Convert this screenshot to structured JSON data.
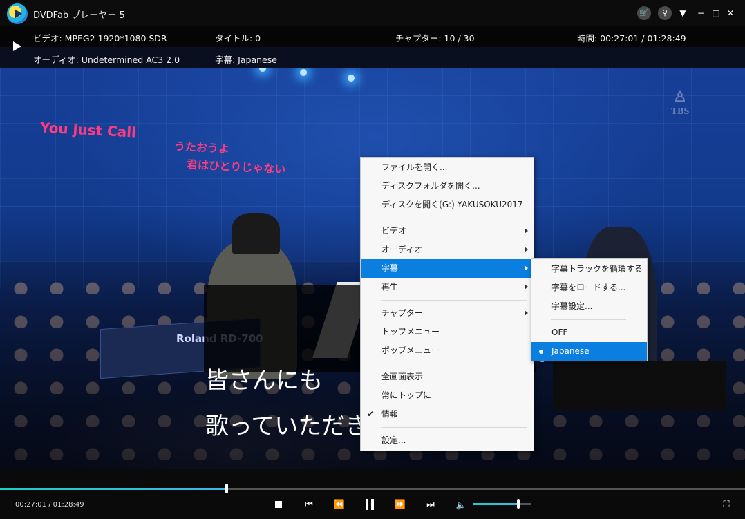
{
  "app": {
    "title": "DVDFab プレーヤー 5"
  },
  "titlebar": {
    "icons": [
      "cart-icon",
      "badge-icon",
      "menu-down-icon",
      "minimize-icon",
      "maximize-icon",
      "close-icon"
    ],
    "glyphs": {
      "cart": "🛒",
      "badge": "⚲",
      "menu": "▼",
      "minimize": "−",
      "maximize": "□",
      "close": "✕"
    }
  },
  "info": {
    "video": "ビデオ: MPEG2  1920*1080 SDR",
    "title": "タイトル: 0",
    "chapter": "チャプター: 10 / 30",
    "time": "時間: 00:27:01 / 01:28:49",
    "audio": "オーディオ: Undetermined  AC3 2.0",
    "subtitle": "字幕: Japanese"
  },
  "video": {
    "lyric_line1": "You just Call",
    "lyric_line2": "うたおうよ",
    "lyric_line3": "君はひとりじゃない",
    "watermark": "TBS",
    "piano_label": "Roland  RD-700",
    "subtitle_line1": "皆さんにも",
    "subtitle_line2": "歌っていただき",
    "accent": "#0a7fe0"
  },
  "context_menu": {
    "items": [
      {
        "label": "ファイルを開く..."
      },
      {
        "label": "ディスクフォルダを開く..."
      },
      {
        "label": "ディスクを開く(G:) YAKUSOKU2017"
      },
      {
        "label": "ビデオ"
      },
      {
        "label": "オーディオ"
      },
      {
        "label": "字幕"
      },
      {
        "label": "再生"
      },
      {
        "label": "チャプター"
      },
      {
        "label": "トップメニュー"
      },
      {
        "label": "ポップメニュー"
      },
      {
        "label": "全画面表示"
      },
      {
        "label": "常にトップに"
      },
      {
        "label": "情報",
        "checked": true
      },
      {
        "label": "設定..."
      }
    ],
    "check_glyph": "✔"
  },
  "subtitle_menu": {
    "items": [
      {
        "label": "字幕トラックを循環する"
      },
      {
        "label": "字幕をロードする..."
      },
      {
        "label": "字幕設定..."
      },
      {
        "label": "OFF"
      },
      {
        "label": "Japanese",
        "selected": true
      }
    ]
  },
  "player": {
    "current_time": "00:27:01",
    "total_time": "01:28:49",
    "time_display": "00:27:01 / 01:28:49",
    "progress": 0.304,
    "volume": 0.78,
    "glyphs": {
      "prev": "⏮",
      "rewind": "⏪",
      "forward": "⏩",
      "next": "⏭",
      "volume": "🔈",
      "fullscreen": "⛶"
    }
  }
}
